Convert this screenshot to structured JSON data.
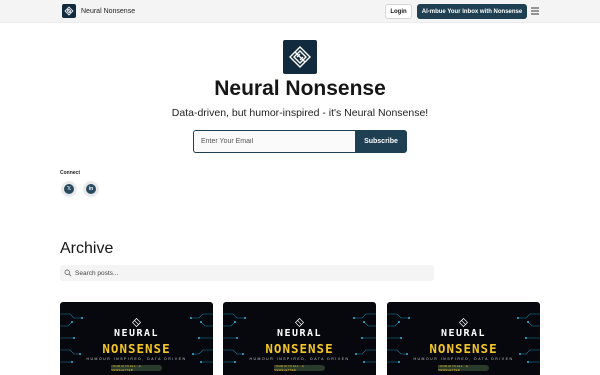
{
  "header": {
    "brand_name": "Neural Nonsense",
    "login_label": "Login",
    "cta_label": "AI-mbue Your Inbox with Nonsense"
  },
  "hero": {
    "title": "Neural Nonsense",
    "tagline": "Data-driven, but humor-inspired - it's Neural Nonsense!",
    "email_placeholder": "Enter Your Email",
    "subscribe_label": "Subscribe"
  },
  "connect": {
    "label": "Connect",
    "links": [
      {
        "icon": "x-twitter-icon",
        "glyph": "𝕏"
      },
      {
        "icon": "linkedin-icon",
        "glyph": "in"
      }
    ]
  },
  "archive": {
    "title": "Archive",
    "search_placeholder": "Search posts...",
    "posts": [
      {
        "line1": "NEURAL",
        "line2": "NONSENSE",
        "tagline": "HUMOUR INSPIRED, DATA DRIVEN",
        "pill": "YOUR AI IN ALL · A NEWSLETTER"
      },
      {
        "line1": "NEURAL",
        "line2": "NONSENSE",
        "tagline": "HUMOUR INSPIRED, DATA DRIVEN",
        "pill": "YOUR AI IN ALL · A NEWSLETTER"
      },
      {
        "line1": "NEURAL",
        "line2": "NONSENSE",
        "tagline": "HUMOUR INSPIRED, DATA DRIVEN",
        "pill": "YOUR AI IN ALL · A NEWSLETTER"
      }
    ]
  },
  "colors": {
    "brand_dark": "#122a3e",
    "button_dark": "#1f3f52",
    "accent_yellow": "#f3c623"
  }
}
